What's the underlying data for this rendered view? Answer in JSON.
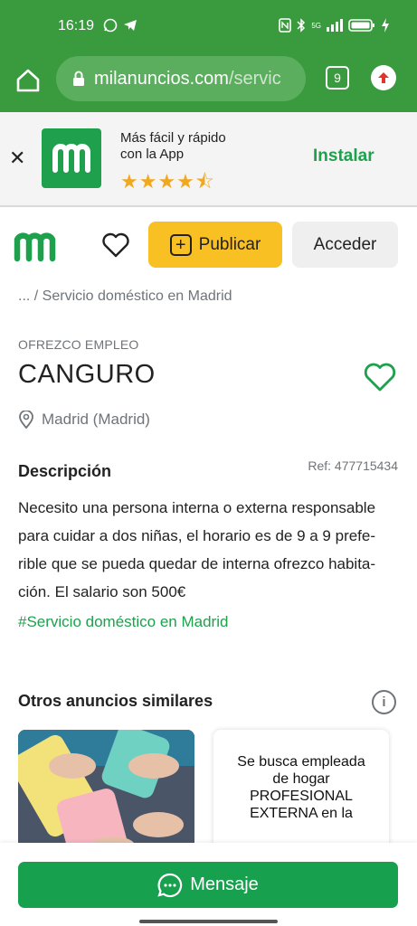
{
  "status_bar": {
    "time": "16:19",
    "network_label": "5G"
  },
  "browser": {
    "url_host": "milanuncios.com",
    "url_path": "/servic",
    "tab_count": "9"
  },
  "app_banner": {
    "line1": "Más fácil y rápido",
    "line2": "con la App",
    "stars": "★★★★⯪",
    "rating_fraction": 0.9,
    "install_label": "Instalar"
  },
  "header": {
    "publish_label": "Publicar",
    "login_label": "Acceder"
  },
  "breadcrumb": {
    "text": "... / Servicio doméstico en Madrid"
  },
  "ad": {
    "category": "OFREZCO EMPLEO",
    "title": "CANGURO",
    "location": "Madrid (Madrid)",
    "description_heading": "Descripción",
    "ref": "Ref: 477715434",
    "description": "Necesito una persona interna o externa responsable  para cuidar a dos niñas, el horario es de 9 a 9 prefe-rible que se pueda quedar de interna ofrezco habita-ción. El salario son 500€",
    "tag": "#Servicio doméstico en Madrid"
  },
  "similar": {
    "heading": "Otros anuncios similares",
    "card2_text": "Se busca empleada de hogar PROFESIONAL EXTERNA en la"
  },
  "bottom": {
    "message_label": "Mensaje"
  },
  "colors": {
    "brand_green": "#1ea04d",
    "browser_green": "#3a9a3e",
    "publish_yellow": "#f8c022"
  }
}
